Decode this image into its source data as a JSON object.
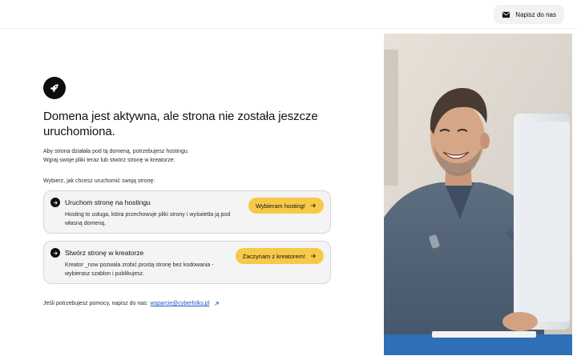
{
  "header": {
    "contact_label": "Napisz do nas",
    "contact_icon": "mail-icon"
  },
  "main": {
    "logo_icon": "rocket-icon",
    "title": "Domena jest aktywna, ale strona nie została jeszcze uruchomiona.",
    "description_line1": "Aby strona działała pod tą domeną, potrzebujesz hostingu.",
    "description_line2": "Wgraj swoje pliki teraz lub stwórz stronę w kreatorze.",
    "choose_label": "Wybierz, jak chcesz uruchomić swoją stronę:",
    "options": [
      {
        "title": "Uruchom stronę na hostingu",
        "description": "Hosting to usługa, która przechowuje pliki strony i wyświetla ją pod własną domeną.",
        "cta": "Wybieram hosting!"
      },
      {
        "title": "Stwórz stronę w kreatorze",
        "description": "Kreator _now pozwala zrobić prostą stronę bez kodowania - wybierasz szablon i publikujesz.",
        "cta": "Zaczynam z kreatorem!"
      }
    ],
    "help_text": "Jeśli potrzebujesz pomocy, napisz do nas:",
    "help_email": "wsparcie@cyberfolks.pl",
    "accent_color": "#f7c948",
    "link_color": "#1a56c7"
  }
}
